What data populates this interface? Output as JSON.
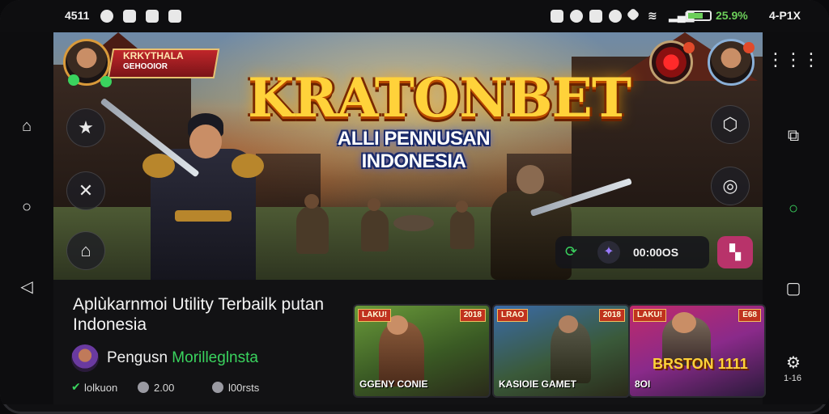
{
  "status_bar": {
    "time": "4511",
    "battery": "25.9%",
    "right_label": "4-P1X",
    "battery_color": "#6ccf5a"
  },
  "banner": {
    "title": "KRATONBET",
    "subtitle": "ALLI PENNUSAN INDONESIA",
    "player_name": "KRKYTHALA",
    "player_sub": "GEHOOIOR",
    "hud_time": "00:00OS",
    "title_color": "#ffd23a"
  },
  "app": {
    "title": "Aplùkarnmoi Utility Terbailk putan Indonesia",
    "developer_prefix": "Pengusn ",
    "developer_highlight": "Morilleglnsta",
    "meta": [
      "lolkuon",
      "2.00",
      "l00rsts"
    ],
    "highlight_color": "#3ad35e"
  },
  "cards": [
    {
      "badge_left": "LAKU!",
      "badge_right": "2018",
      "label": "GGENY CONIE",
      "big": ""
    },
    {
      "badge_left": "LRAO",
      "badge_right": "2018",
      "label": "KASIOIE GAMET",
      "big": ""
    },
    {
      "badge_left": "LAKU!",
      "badge_right": "E68",
      "label": "8OI",
      "big": "BRSTON 1111"
    }
  ],
  "icons": {
    "left_nav": [
      "home-icon",
      "circle-icon",
      "back-icon"
    ],
    "right_nav": [
      "grid-menu-icon",
      "share-icon",
      "circle-icon",
      "square-icon",
      "settings-icon"
    ],
    "settings_label": "1-16"
  }
}
